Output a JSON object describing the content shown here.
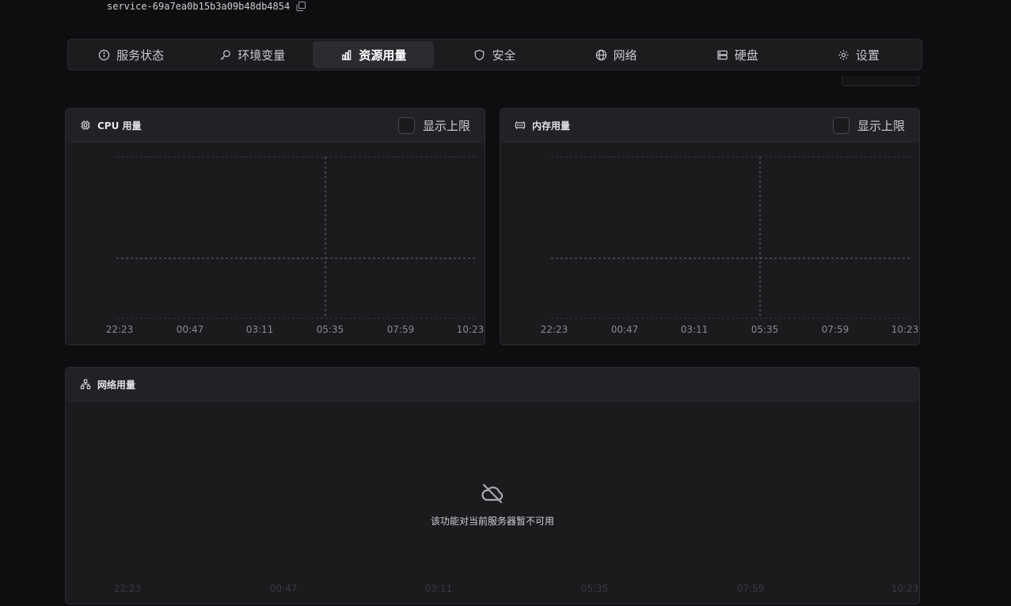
{
  "service": {
    "id": "service-69a7ea0b15b3a09b48db4854"
  },
  "tabs": [
    {
      "label": "服务状态",
      "icon": "info-icon",
      "active": false
    },
    {
      "label": "环境变量",
      "icon": "key-icon",
      "active": false
    },
    {
      "label": "资源用量",
      "icon": "bar-chart-icon",
      "active": true
    },
    {
      "label": "安全",
      "icon": "shield-icon",
      "active": false
    },
    {
      "label": "网络",
      "icon": "globe-icon",
      "active": false
    },
    {
      "label": "硬盘",
      "icon": "server-icon",
      "active": false
    },
    {
      "label": "设置",
      "icon": "gear-icon",
      "active": false
    }
  ],
  "cpu": {
    "title": "CPU 用量",
    "limit_label": "显示上限",
    "limit_checked": false,
    "x_ticks": [
      "22:23",
      "00:47",
      "03:11",
      "05:35",
      "07:59",
      "10:23"
    ]
  },
  "memory": {
    "title": "内存用量",
    "limit_label": "显示上限",
    "limit_checked": false,
    "x_ticks": [
      "22:23",
      "00:47",
      "03:11",
      "05:35",
      "07:59",
      "10:23"
    ]
  },
  "network": {
    "title": "网络用量",
    "unavailable_text": "该功能对当前服务器暂不可用",
    "x_ticks": [
      "22:23",
      "00:47",
      "03:11",
      "05:35",
      "07:59",
      "10:23"
    ]
  },
  "colors": {
    "background": "#0e0e10",
    "card": "#1b1b1e",
    "accent_text": "#ffffff"
  }
}
